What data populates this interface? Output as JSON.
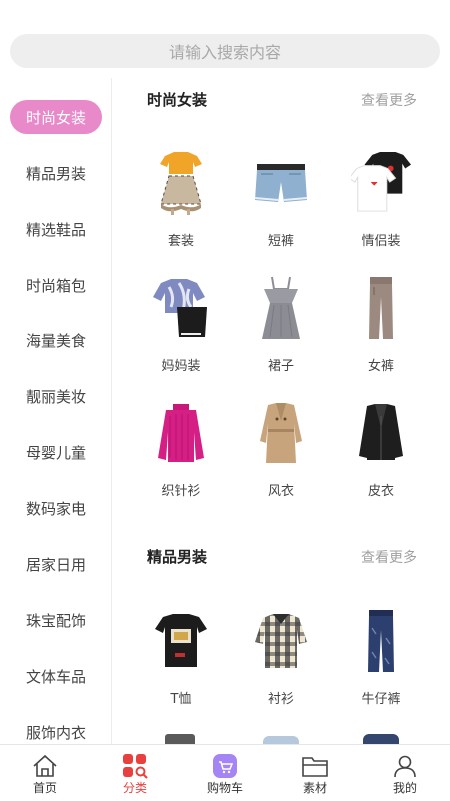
{
  "search": {
    "placeholder": "请输入搜索内容"
  },
  "sidebar": {
    "items": [
      {
        "label": "时尚女装",
        "active": true
      },
      {
        "label": "精品男装"
      },
      {
        "label": "精选鞋品"
      },
      {
        "label": "时尚箱包"
      },
      {
        "label": "海量美食"
      },
      {
        "label": "靓丽美妆"
      },
      {
        "label": "母婴儿童"
      },
      {
        "label": "数码家电"
      },
      {
        "label": "居家日用"
      },
      {
        "label": "珠宝配饰"
      },
      {
        "label": "文体车品"
      },
      {
        "label": "服饰内衣"
      }
    ]
  },
  "sections": [
    {
      "title": "时尚女装",
      "more": "查看更多",
      "items": [
        {
          "label": "套装",
          "icon": "outfit-set-icon"
        },
        {
          "label": "短裤",
          "icon": "denim-shorts-icon"
        },
        {
          "label": "情侣装",
          "icon": "couple-tshirts-icon"
        },
        {
          "label": "妈妈装",
          "icon": "mom-outfit-icon"
        },
        {
          "label": "裙子",
          "icon": "dress-icon"
        },
        {
          "label": "女裤",
          "icon": "women-pants-icon"
        },
        {
          "label": "织针衫",
          "icon": "knit-sweater-icon"
        },
        {
          "label": "风衣",
          "icon": "trench-coat-icon"
        },
        {
          "label": "皮衣",
          "icon": "leather-jacket-icon"
        }
      ]
    },
    {
      "title": "精品男装",
      "more": "查看更多",
      "items": [
        {
          "label": "T恤",
          "icon": "tshirt-icon"
        },
        {
          "label": "衬衫",
          "icon": "plaid-shirt-icon"
        },
        {
          "label": "牛仔裤",
          "icon": "jeans-icon"
        }
      ]
    }
  ],
  "tabbar": {
    "items": [
      {
        "label": "首页",
        "icon": "home-icon"
      },
      {
        "label": "分类",
        "icon": "category-icon",
        "active": true
      },
      {
        "label": "购物车",
        "icon": "cart-icon"
      },
      {
        "label": "素材",
        "icon": "folder-icon"
      },
      {
        "label": "我的",
        "icon": "user-icon"
      }
    ]
  },
  "colors": {
    "accent": "#e889c9",
    "active_tab": "#e8403f",
    "cart_purple": "#a585f3"
  }
}
